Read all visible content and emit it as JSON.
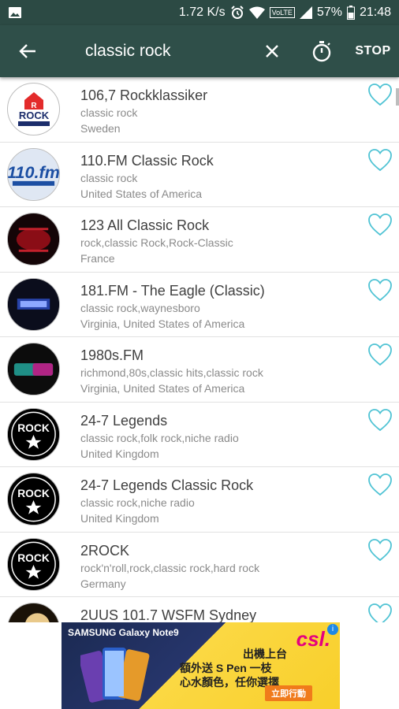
{
  "status_bar": {
    "speed": "1.72 K/s",
    "network": "VoLTE",
    "battery": "57%",
    "time": "21:48"
  },
  "search": {
    "query": "classic rock",
    "stop_label": "STOP"
  },
  "stations": [
    {
      "name": "106,7 Rockklassiker",
      "tags": "classic rock",
      "country": "Sweden",
      "logo_icon": "rock-klassiker-logo"
    },
    {
      "name": "110.FM Classic Rock",
      "tags": "classic rock",
      "country": "United States of America",
      "logo_icon": "110fm-logo"
    },
    {
      "name": "123 All Classic Rock",
      "tags": "rock,classic Rock,Rock-Classic",
      "country": "France",
      "logo_icon": "123-all-classic-rock-logo"
    },
    {
      "name": "181.FM - The Eagle (Classic)",
      "tags": "classic rock,waynesboro",
      "country": "Virginia, United States of America",
      "logo_icon": "181fm-logo"
    },
    {
      "name": "1980s.FM",
      "tags": "richmond,80s,classic hits,classic rock",
      "country": "Virginia, United States of America",
      "logo_icon": "1980sfm-logo"
    },
    {
      "name": "24-7 Legends",
      "tags": "classic rock,folk rock,niche radio",
      "country": "United Kingdom",
      "logo_icon": "rock-star-logo"
    },
    {
      "name": "24-7 Legends Classic Rock",
      "tags": "classic rock,niche radio",
      "country": "United Kingdom",
      "logo_icon": "rock-star-logo"
    },
    {
      "name": "2ROCK",
      "tags": "rock'n'roll,rock,classic rock,hard rock",
      "country": "Germany",
      "logo_icon": "rock-star-logo"
    },
    {
      "name": "2UUS 101.7 WSFM Sydney",
      "tags": "",
      "country": "",
      "logo_icon": "wsfm-logo"
    }
  ],
  "ad": {
    "brand": "SAMSUNG Galaxy Note9",
    "logo": "csl.",
    "line1": "出機上台",
    "line2": "額外送 S Pen 一枝",
    "line3": "心水顏色，任你選擇",
    "cta": "立即行動"
  },
  "colors": {
    "toolbar": "#2f4f49",
    "status_bar": "#2c4a44",
    "accent": "#4fc3d4",
    "cursor": "#e0457b"
  }
}
